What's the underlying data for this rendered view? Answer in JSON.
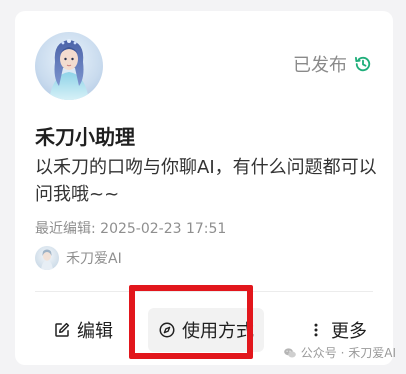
{
  "card": {
    "status_label": "已发布",
    "status_icon": "history-icon",
    "title": "禾刀小助理",
    "description": "以禾刀的口吻与你聊AI，有什么问题都可以问我哦~~",
    "last_edited": "最近编辑: 2025-02-23 17:51",
    "author_name": "禾刀爱AI"
  },
  "actions": {
    "edit_label": "编辑",
    "usage_label": "使用方式",
    "more_label": "更多"
  },
  "watermark": "公众号 · 禾刀爱AI",
  "colors": {
    "accent_green": "#1fae7a",
    "highlight_red": "#e2161c"
  }
}
